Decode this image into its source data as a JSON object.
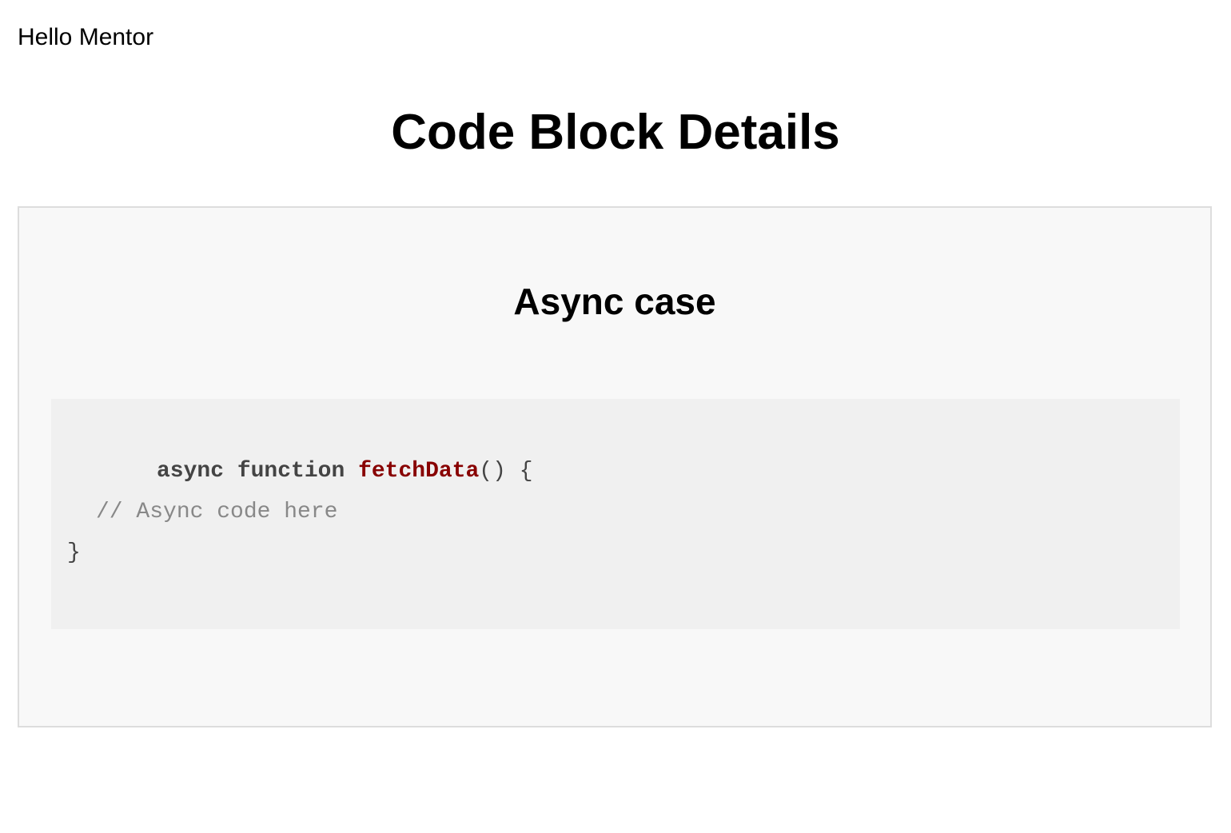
{
  "header": {
    "greeting": "Hello Mentor"
  },
  "page": {
    "title": "Code Block Details"
  },
  "card": {
    "title": "Async case",
    "code": {
      "language": "javascript",
      "keyword_async": "async",
      "keyword_function": "function",
      "function_name": "fetchData",
      "signature_rest": "()",
      "open_brace": "{",
      "comment": "// Async code here",
      "close_brace": "}"
    }
  },
  "colors": {
    "page_background": "#ffffff",
    "card_background": "#f8f8f8",
    "card_border": "#dddddd",
    "code_background": "#f0f0f0",
    "keyword": "#444444",
    "function_name": "#880000",
    "comment": "#888888"
  }
}
